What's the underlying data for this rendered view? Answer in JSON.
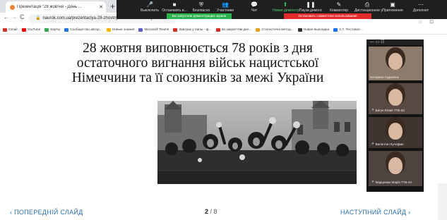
{
  "browser": {
    "tab_title": "Презентація \"28 жовтня - День ...",
    "tab_close": "✕",
    "new_tab": "+",
    "url": "naurok.com.ua/prezentaciya-28-zhovtnya---den-vizvolennya",
    "back": "←",
    "forward": "→",
    "reload": "C",
    "right_controls": "☆ ⊡ ⋮"
  },
  "bookmarks": [
    {
      "label": "Gmail",
      "color": "#d93025"
    },
    {
      "label": "YouTube",
      "color": "#ff0000"
    },
    {
      "label": "Карты",
      "color": "#34a853"
    },
    {
      "label": "Сообщество автор...",
      "color": "#1a73e8"
    },
    {
      "label": "Новые знания",
      "color": "#f4b400"
    },
    {
      "label": "Microsoft Teams",
      "color": "#5b5fc7"
    },
    {
      "label": "Завтрак у папы - ф...",
      "color": "#d93025"
    },
    {
      "label": "За закриттям дел...",
      "color": "#d93025"
    },
    {
      "label": "Статистичні метод...",
      "color": "#e3a21a"
    },
    {
      "label": "Новая выкладка",
      "color": "#333333"
    },
    {
      "label": "3.7. Тестовое...",
      "color": "#1a73e8"
    }
  ],
  "zoom_toolbar": {
    "items": [
      {
        "icon": "🎤",
        "label": "Выключить",
        "id": "mute"
      },
      {
        "icon": "■",
        "label": "Остановить в...",
        "id": "video"
      },
      {
        "icon": "⛨",
        "label": "Безопасно",
        "id": "security"
      },
      {
        "icon": "👥",
        "label": "Участники",
        "id": "participants"
      },
      {
        "icon": "💬",
        "label": "Чат",
        "id": "chat"
      },
      {
        "icon": "⬆",
        "label": "Новая демонстр",
        "id": "demo"
      },
      {
        "icon": "❚❚",
        "label": "Пауза демонс",
        "id": "pause"
      },
      {
        "icon": "✎",
        "label": "Комментир",
        "id": "annotate"
      },
      {
        "icon": "⎙",
        "label": "Дистанционное у",
        "id": "remote"
      },
      {
        "icon": "▣",
        "label": "Приложения",
        "id": "apps"
      },
      {
        "icon": "⋯",
        "label": "Дополнит",
        "id": "more"
      }
    ],
    "share_notice": "Вы запустили демонстрацию экрана",
    "stop_share": "Остановить совместное использование"
  },
  "slide": {
    "heading_lines": [
      "28 жовтня виповнюється 78 років з дня",
      "остаточного вигнання військ нацистської",
      "Німеччини та її союзників за межі України"
    ],
    "prev_label": "‹ ПОПЕРЕДНІЙ СЛАЙД",
    "next_label": "НАСТУПНИЙ СЛАЙД ›",
    "current_page": "2",
    "total_pages": "/ 8"
  },
  "participants": [
    {
      "name": "Катерина Гадзалюк",
      "muted": false,
      "bg": "#8d7b6b"
    },
    {
      "name": "Бигун Юлия ТТБ-34",
      "muted": true,
      "bg": "#5a4a44"
    },
    {
      "name": "Валентин Кучафин",
      "muted": true,
      "bg": "#3f3530"
    },
    {
      "name": "Марценюк Марія ТТБ-34",
      "muted": true,
      "bg": "#4d4440"
    }
  ],
  "colors": {
    "zoom_bar": "#1f1f1f",
    "share_green": "#2bb24c",
    "share_red": "#e22c2c",
    "slide_nav": "#2a6fb0"
  }
}
